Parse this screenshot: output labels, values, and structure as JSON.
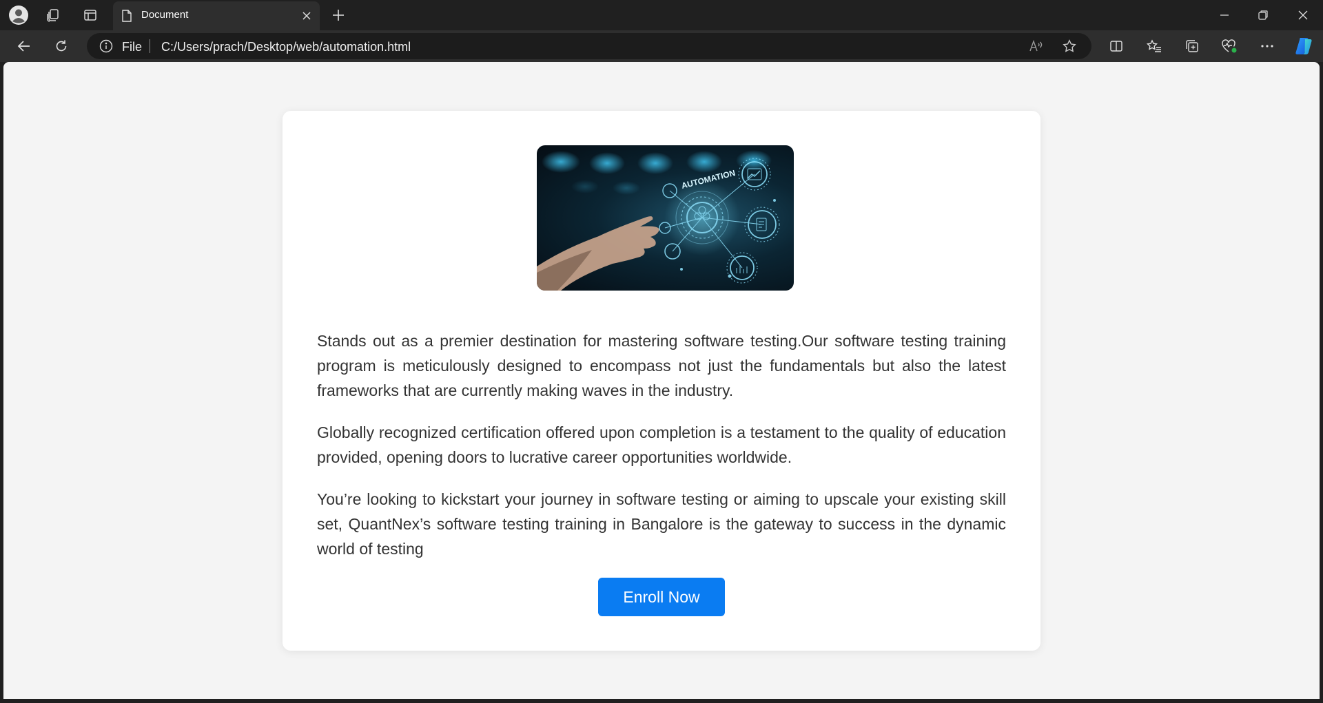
{
  "browser": {
    "tab": {
      "title": "Document"
    },
    "address": {
      "scheme": "File",
      "url": "C:/Users/prach/Desktop/web/automation.html"
    }
  },
  "page": {
    "image": {
      "caption": "AUTOMATION"
    },
    "paragraphs": [
      "Stands out as a premier destination for mastering software testing.Our software testing training program is meticulously designed to encompass not just the fundamentals but also the latest frameworks that are currently making waves in the industry.",
      "Globally recognized certification offered upon completion is a testament to the quality of education provided, opening doors to lucrative career opportunities worldwide.",
      "You’re looking to kickstart your journey in software testing or aiming to upscale your existing skill set, QuantNex’s software testing training in Bangalore is the gateway to success in the dynamic world of testing"
    ],
    "enroll_button": "Enroll Now"
  },
  "colors": {
    "button": "#0a7cf2",
    "page_background": "#f4f4f4",
    "card": "#ffffff",
    "chrome": "#202020"
  }
}
